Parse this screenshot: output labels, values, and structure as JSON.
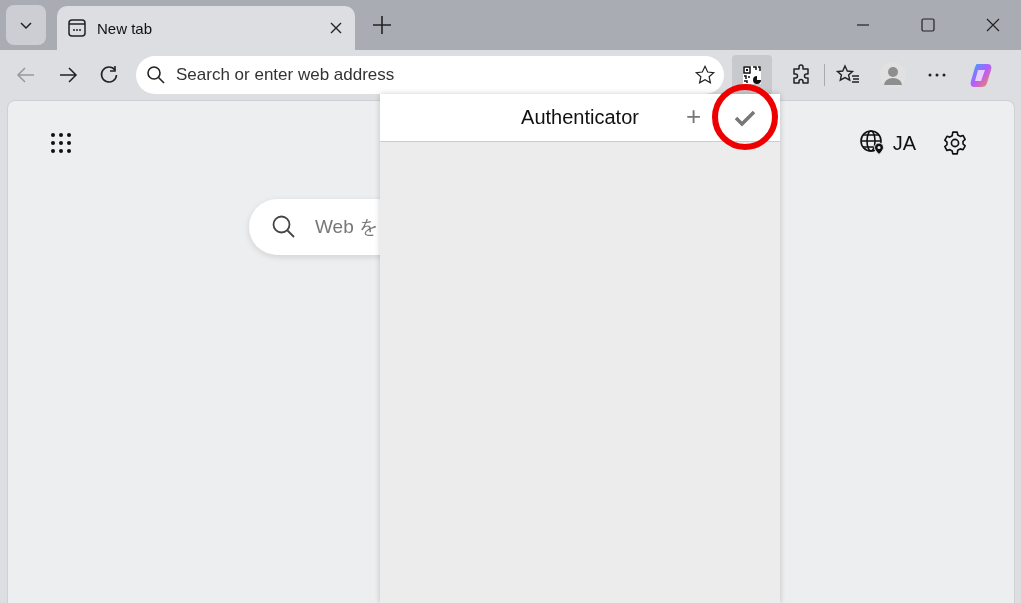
{
  "tabs": [
    {
      "title": "New tab",
      "selected": true
    }
  ],
  "address_bar": {
    "placeholder": "Search or enter web address"
  },
  "page": {
    "search": {
      "placeholder": "Web を"
    },
    "language": "JA"
  },
  "popup": {
    "title": "Authenticator",
    "add": "+"
  }
}
